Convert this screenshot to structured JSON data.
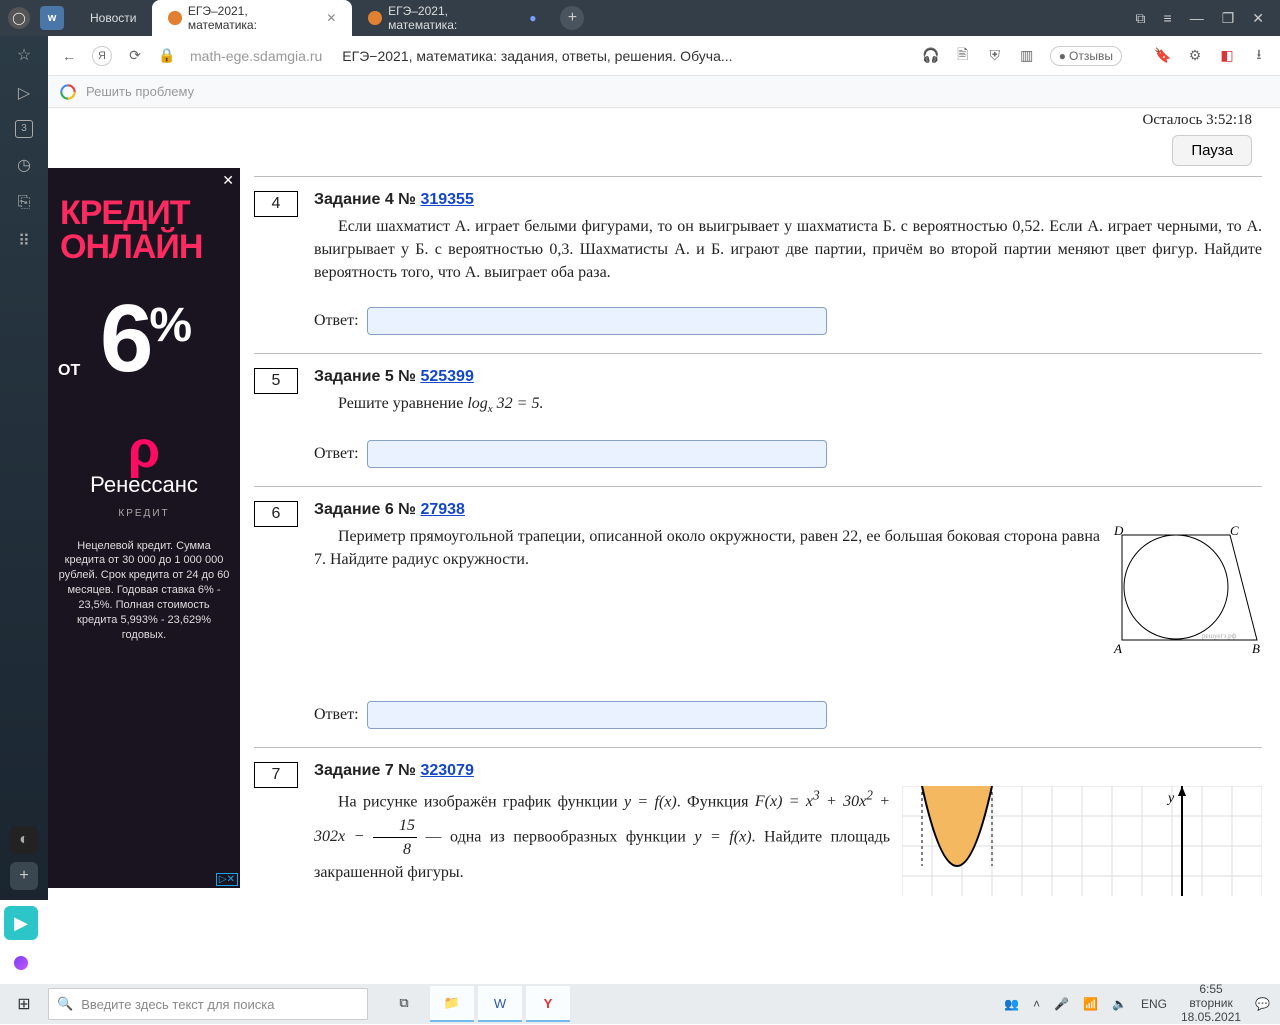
{
  "browser": {
    "tabs": {
      "news": "Новости",
      "active": "ЕГЭ–2021, математика:",
      "inactive": "ЕГЭ–2021, математика:"
    },
    "url": "math-ege.sdamgia.ru",
    "page_title": "ЕГЭ−2021, математика: задания, ответы, решения. Обуча...",
    "reviews": "Отзывы",
    "search_placeholder": "Решить проблему"
  },
  "timer": {
    "label": "Осталось",
    "value": "3:52:18",
    "pause": "Пауза"
  },
  "tasks": {
    "t4": {
      "num": "4",
      "title": "Задание 4 № ",
      "link": "319355",
      "text": "Если шахматист А. играет белыми фигурами, то он выигрывает у шахматиста Б. с вероятностью 0,52. Если А. играет черными, то А. выигрывает у Б. с вероятностью 0,3. Шахматисты А. и Б. играют две партии, причём во второй партии меняют цвет фигур. Найдите вероятность того, что А. выиграет оба раза.",
      "answer_label": "Ответ:"
    },
    "t5": {
      "num": "5",
      "title": "Задание 5 № ",
      "link": "525399",
      "text_pre": "Решите уравнение  ",
      "math": "logₓ 32 = 5.",
      "answer_label": "Ответ:"
    },
    "t6": {
      "num": "6",
      "title": "Задание 6 № ",
      "link": "27938",
      "text": "Периметр прямоугольной трапеции, описанной около окружности, равен 22, ее большая боковая сторона равна 7. Найдите радиус окружности.",
      "answer_label": "Ответ:"
    },
    "t7": {
      "num": "7",
      "title": "Задание 7 № ",
      "link": "323079",
      "text1": "На рисунке изображён график функции ",
      "text1b": ". Функция ",
      "text2": " — одна из первообразных функции ",
      "text3": ". Найдите площадь закрашенной фигуры."
    }
  },
  "ad": {
    "headline1": "КРЕДИТ",
    "headline2": "ОНЛАЙН",
    "from": "ОТ",
    "percent": "6",
    "pct_sign": "%",
    "brand": "Ренессанс",
    "brand_sub": "КРЕДИТ",
    "fine": "Нецелевой кредит. Сумма кредита от 30 000 до 1 000 000 рублей. Срок кредита от 24 до 60 месяцев. Годовая ставка 6% - 23,5%. Полная стоимость кредита 5,993% - 23,629% годовых."
  },
  "taskbar": {
    "search_placeholder": "Введите здесь текст для поиска",
    "lang": "ENG",
    "time": "6:55",
    "weekday": "вторник",
    "date": "18.05.2021"
  },
  "fig6": {
    "D": "D",
    "C": "C",
    "A": "A",
    "B": "B",
    "wm": "решуегэ.рф"
  },
  "fig7": {
    "y": "y"
  }
}
